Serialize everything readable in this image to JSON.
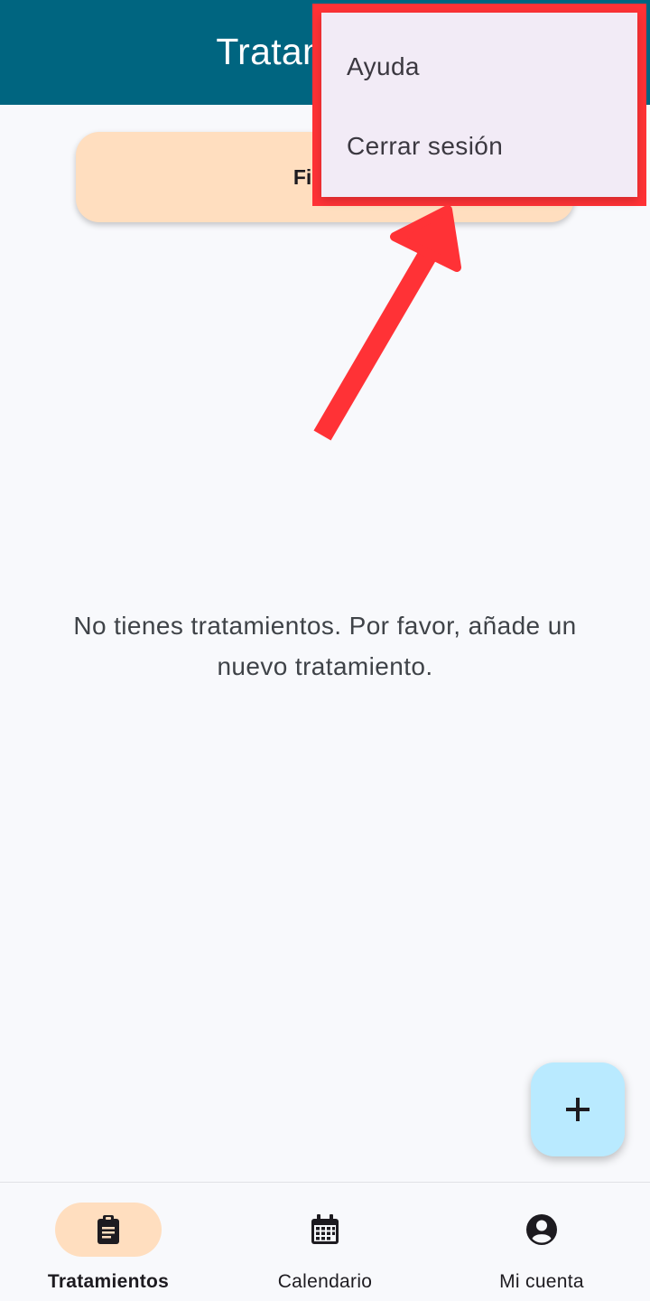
{
  "app_bar": {
    "title": "Tratamientos",
    "color": "#006580"
  },
  "filter_button": {
    "label": "Filtros"
  },
  "empty_state": {
    "message": "No tienes tratamientos. Por favor, añade un nuevo tratamiento."
  },
  "overflow_menu": {
    "items": [
      {
        "label": "Ayuda"
      },
      {
        "label": "Cerrar sesión"
      }
    ],
    "highlight_color": "#ff3236"
  },
  "fab": {
    "icon": "plus-icon",
    "color": "#b9eaff"
  },
  "bottom_nav": {
    "items": [
      {
        "label": "Tratamientos",
        "icon": "clipboard-icon",
        "active": true
      },
      {
        "label": "Calendario",
        "icon": "calendar-icon",
        "active": false
      },
      {
        "label": "Mi cuenta",
        "icon": "account-circle-icon",
        "active": false
      }
    ],
    "active_indicator_color": "#ffdebf"
  }
}
